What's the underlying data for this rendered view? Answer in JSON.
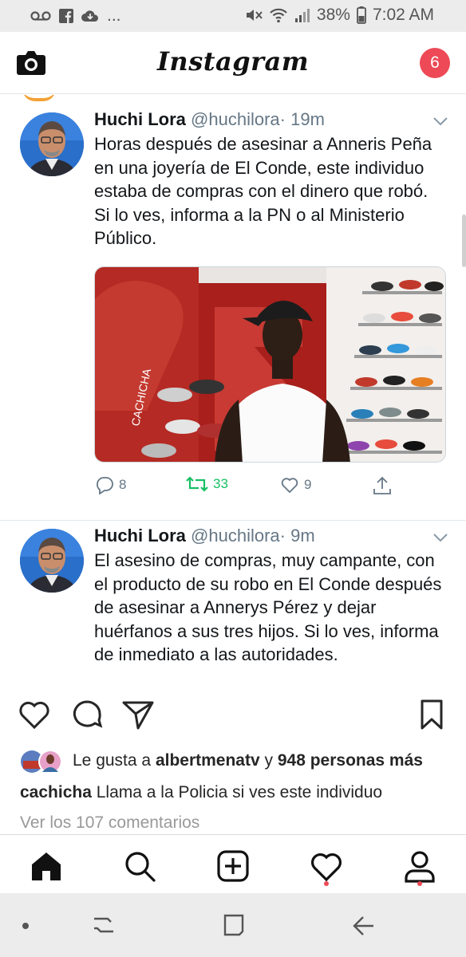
{
  "status_bar": {
    "left_extra": "...",
    "battery": "38%",
    "time": "7:02 AM"
  },
  "header": {
    "logo": "Instagram",
    "notifications": "6"
  },
  "tweets": [
    {
      "name": "Huchi Lora",
      "handle": "@huchilora",
      "time": "· 19m",
      "text": "Horas después de asesinar a Anneris Peña en una joyería de El Conde, este individuo estaba de compras con el dinero que robó. Si lo ves, informa a la PN o al Ministerio Público.",
      "photo_watermark": "CACHICHA",
      "replies": "8",
      "retweets": "33",
      "likes": "9"
    },
    {
      "name": "Huchi Lora",
      "handle": "@huchilora",
      "time": "· 9m",
      "text": "El asesino de compras, muy campante, con el producto de su robo en El Conde después de asesinar a Annerys Pérez y dejar huérfanos a sus tres hijos. Si lo ves, informa de inmediato a las autoridades."
    }
  ],
  "post": {
    "likes_prefix": "Le gusta a",
    "likes_user": "albertmenatv",
    "likes_join": "y",
    "likes_count": "948 personas más",
    "caption_user": "cachicha",
    "caption_text": "Llama a la Policia si ves este individuo",
    "view_comments": "Ver los 107 comentarios"
  },
  "icons": {
    "camera": "camera-icon",
    "heart": "heart-icon",
    "comment": "comment-icon",
    "share": "send-icon",
    "save": "bookmark-icon",
    "home": "home-icon",
    "search": "search-icon",
    "add": "add-post-icon",
    "activity": "activity-heart-icon",
    "profile": "profile-icon"
  },
  "colors": {
    "badge": "#ed4956",
    "retweet": "#17bf63",
    "twitter_gray": "#657786"
  }
}
